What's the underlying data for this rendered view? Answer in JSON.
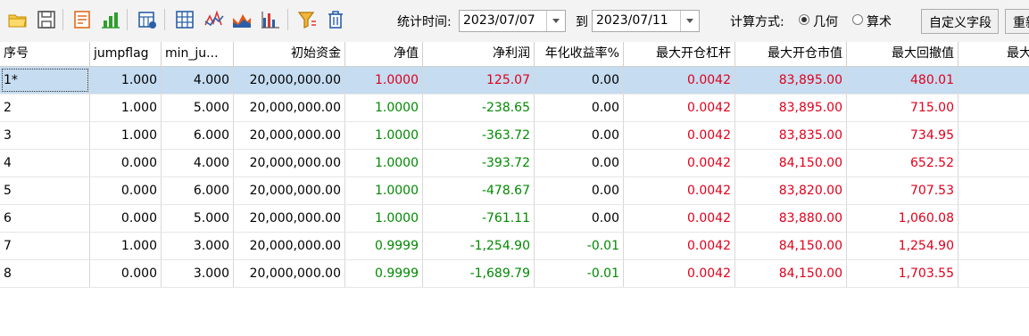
{
  "toolbar": {
    "icons": [
      "open-folder-icon",
      "save-icon",
      "report-icon",
      "bar-chart-icon",
      "calendar-grid-icon",
      "table-icon",
      "line-chart-icon",
      "area-chart-icon",
      "column-chart-icon",
      "filter-icon",
      "delete-icon"
    ],
    "stat_time_label": "统计时间:",
    "start_date": "2023/07/07",
    "to_label": "到",
    "end_date": "2023/07/11",
    "calc_method_label": "计算方式:",
    "radio_geometric": "几何",
    "radio_arithmetic": "算术",
    "custom_field_button": "自定义字段",
    "reset_button": "重新"
  },
  "table": {
    "columns": [
      "序号",
      "jumpflag",
      "min_ju...",
      "初始资金",
      "净值",
      "净利润",
      "年化收益率%",
      "最大开仓杠杆",
      "最大开仓市值",
      "最大回撤值",
      "最大回"
    ],
    "rows": [
      {
        "idx": "1*",
        "jumpflag": "1.000",
        "min_ju": "4.000",
        "capital": "20,000,000.00",
        "nav": "1.0000",
        "profit": "125.07",
        "annual": "0.00",
        "lev": "0.0042",
        "mktval": "83,895.00",
        "drawdown": "480.01"
      },
      {
        "idx": "2",
        "jumpflag": "1.000",
        "min_ju": "5.000",
        "capital": "20,000,000.00",
        "nav": "1.0000",
        "profit": "-238.65",
        "annual": "0.00",
        "lev": "0.0042",
        "mktval": "83,895.00",
        "drawdown": "715.00"
      },
      {
        "idx": "3",
        "jumpflag": "1.000",
        "min_ju": "6.000",
        "capital": "20,000,000.00",
        "nav": "1.0000",
        "profit": "-363.72",
        "annual": "0.00",
        "lev": "0.0042",
        "mktval": "83,835.00",
        "drawdown": "734.95"
      },
      {
        "idx": "4",
        "jumpflag": "0.000",
        "min_ju": "4.000",
        "capital": "20,000,000.00",
        "nav": "1.0000",
        "profit": "-393.72",
        "annual": "0.00",
        "lev": "0.0042",
        "mktval": "84,150.00",
        "drawdown": "652.52"
      },
      {
        "idx": "5",
        "jumpflag": "0.000",
        "min_ju": "6.000",
        "capital": "20,000,000.00",
        "nav": "1.0000",
        "profit": "-478.67",
        "annual": "0.00",
        "lev": "0.0042",
        "mktval": "83,820.00",
        "drawdown": "707.53"
      },
      {
        "idx": "6",
        "jumpflag": "0.000",
        "min_ju": "5.000",
        "capital": "20,000,000.00",
        "nav": "1.0000",
        "profit": "-761.11",
        "annual": "0.00",
        "lev": "0.0042",
        "mktval": "83,880.00",
        "drawdown": "1,060.08"
      },
      {
        "idx": "7",
        "jumpflag": "1.000",
        "min_ju": "3.000",
        "capital": "20,000,000.00",
        "nav": "0.9999",
        "profit": "-1,254.90",
        "annual": "-0.01",
        "lev": "0.0042",
        "mktval": "84,150.00",
        "drawdown": "1,254.90"
      },
      {
        "idx": "8",
        "jumpflag": "0.000",
        "min_ju": "3.000",
        "capital": "20,000,000.00",
        "nav": "0.9999",
        "profit": "-1,689.79",
        "annual": "-0.01",
        "lev": "0.0042",
        "mktval": "84,150.00",
        "drawdown": "1,703.55"
      }
    ]
  },
  "colors": {
    "positive": "#e0001b",
    "negative": "#008a00",
    "selected_row": "#c5dcf1"
  }
}
